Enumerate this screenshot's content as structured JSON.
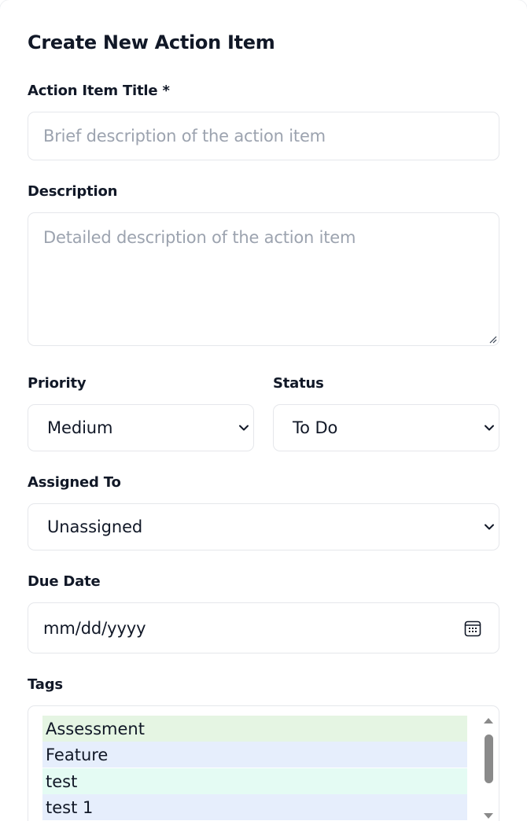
{
  "form": {
    "title": "Create New Action Item",
    "title_field": {
      "label": "Action Item Title *",
      "placeholder": "Brief description of the action item",
      "value": ""
    },
    "description_field": {
      "label": "Description",
      "placeholder": "Detailed description of the action item",
      "value": ""
    },
    "priority": {
      "label": "Priority",
      "selected": "Medium"
    },
    "status": {
      "label": "Status",
      "selected": "To Do"
    },
    "assigned_to": {
      "label": "Assigned To",
      "selected": "Unassigned"
    },
    "due_date": {
      "label": "Due Date",
      "placeholder": "mm/dd/yyyy",
      "icon": "calendar-icon"
    },
    "tags": {
      "label": "Tags",
      "options": [
        {
          "label": "Assessment",
          "color": "#e5f5e3"
        },
        {
          "label": "Feature",
          "color": "#e6eefc"
        },
        {
          "label": "test",
          "color": "#e4fbf3"
        },
        {
          "label": "test 1",
          "color": "#e6eefc"
        }
      ]
    }
  },
  "colors": {
    "border": "#e5e7eb",
    "placeholder": "#9ca3af",
    "text": "#111827"
  }
}
